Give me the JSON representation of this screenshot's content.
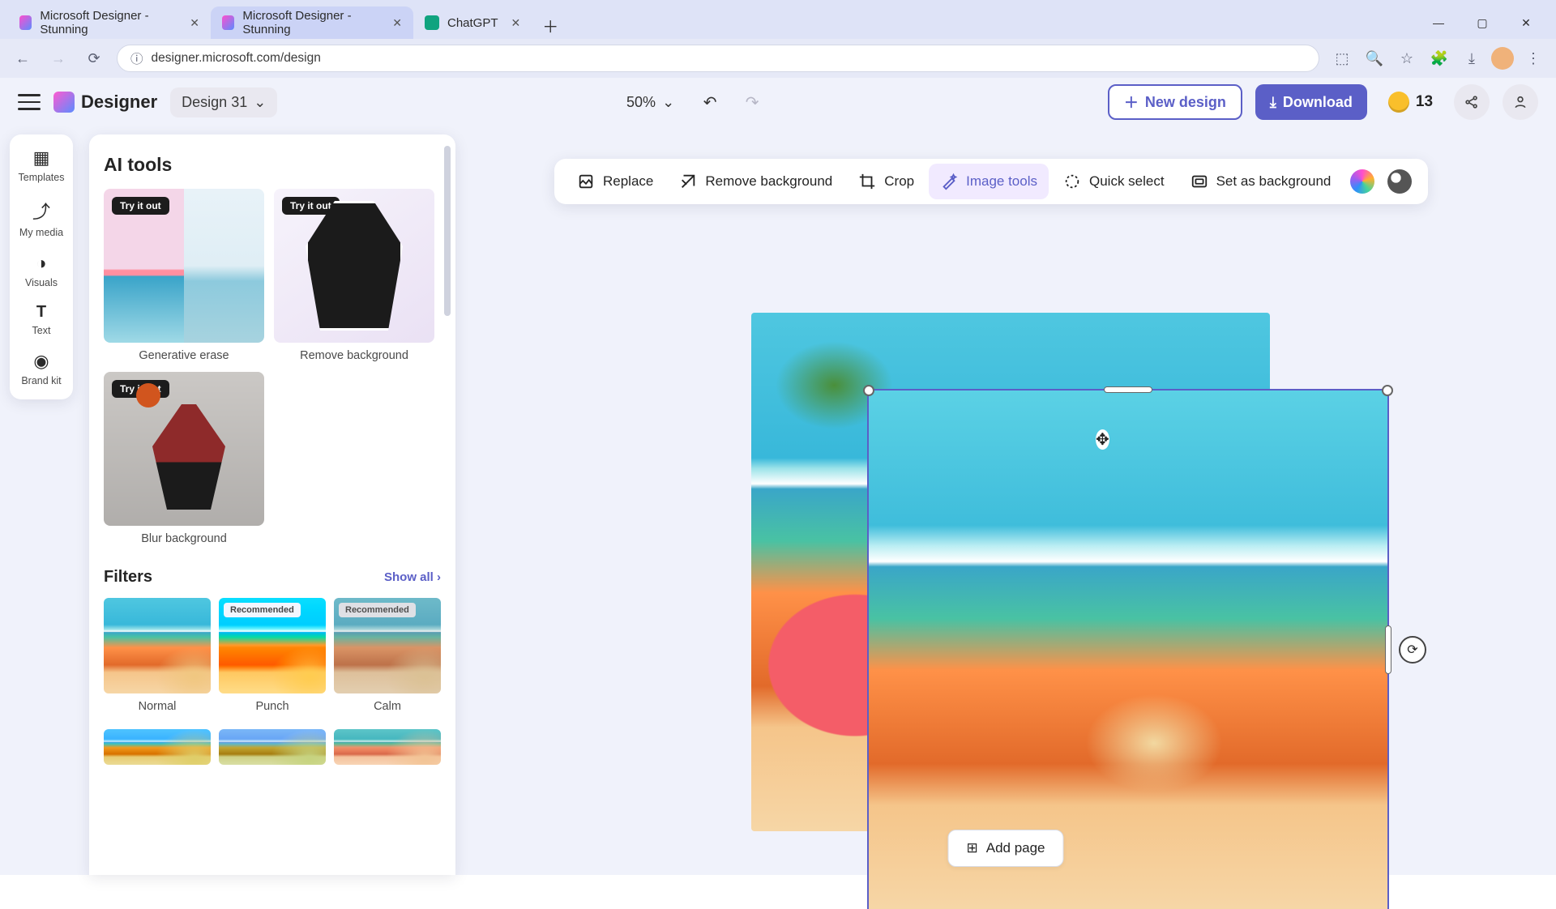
{
  "browser": {
    "tabs": [
      {
        "title": "Microsoft Designer - Stunning"
      },
      {
        "title": "Microsoft Designer - Stunning"
      },
      {
        "title": "ChatGPT"
      }
    ],
    "url": "designer.microsoft.com/design"
  },
  "header": {
    "brand": "Designer",
    "design_name": "Design 31",
    "zoom": "50%",
    "new_design": "New design",
    "download": "Download",
    "coins": "13"
  },
  "rail": {
    "templates": "Templates",
    "my_media": "My media",
    "visuals": "Visuals",
    "text": "Text",
    "brand_kit": "Brand kit"
  },
  "panel": {
    "ai_tools_title": "AI tools",
    "try_it_out": "Try it out",
    "cards": {
      "generative_erase": "Generative erase",
      "remove_background": "Remove background",
      "blur_background": "Blur background"
    },
    "filters_title": "Filters",
    "show_all": "Show all",
    "recommended": "Recommended",
    "filters": {
      "normal": "Normal",
      "punch": "Punch",
      "calm": "Calm"
    }
  },
  "context_toolbar": {
    "replace": "Replace",
    "remove_bg": "Remove background",
    "crop": "Crop",
    "image_tools": "Image tools",
    "quick_select": "Quick select",
    "set_bg": "Set as background"
  },
  "footer": {
    "add_page": "Add page"
  }
}
